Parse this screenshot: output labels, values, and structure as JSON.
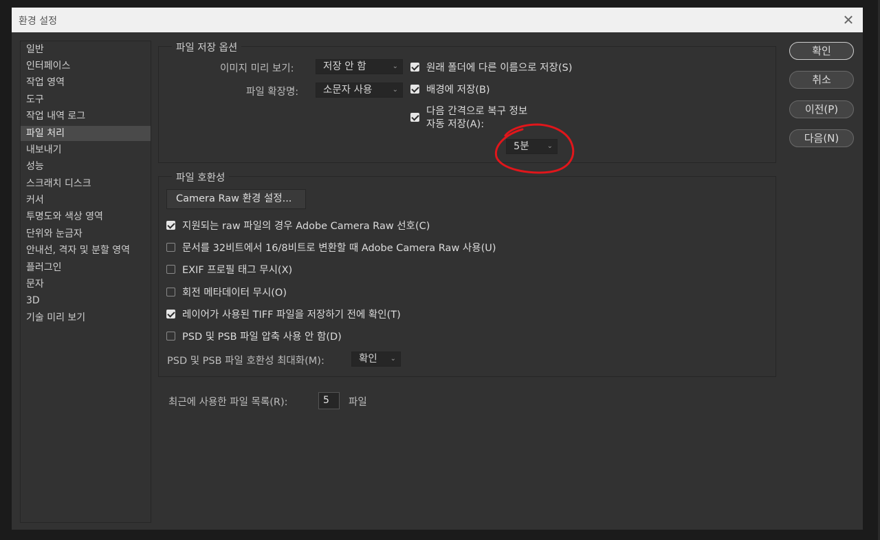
{
  "window": {
    "title": "환경 설정",
    "close_glyph": "✕"
  },
  "sidebar": {
    "items": [
      {
        "label": "일반"
      },
      {
        "label": "인터페이스"
      },
      {
        "label": "작업 영역"
      },
      {
        "label": "도구"
      },
      {
        "label": "작업 내역 로그"
      },
      {
        "label": "파일 처리",
        "selected": true
      },
      {
        "label": "내보내기"
      },
      {
        "label": "성능"
      },
      {
        "label": "스크래치 디스크"
      },
      {
        "label": "커서"
      },
      {
        "label": "투명도와 색상 영역"
      },
      {
        "label": "단위와 눈금자"
      },
      {
        "label": "안내선, 격자 및 분할 영역"
      },
      {
        "label": "플러그인"
      },
      {
        "label": "문자"
      },
      {
        "label": "3D"
      },
      {
        "label": "기술 미리 보기"
      }
    ]
  },
  "save_options": {
    "legend": "파일 저장 옵션",
    "image_preview_label": "이미지 미리 보기:",
    "image_preview_value": "저장 안 함",
    "file_ext_label": "파일 확장명:",
    "file_ext_value": "소문자 사용",
    "save_in_original_folder": {
      "label": "원래 폴더에 다른 이름으로 저장(S)",
      "checked": true
    },
    "save_in_background": {
      "label": "배경에 저장(B)",
      "checked": true
    },
    "auto_recovery": {
      "label_line1": "다음 간격으로 복구 정보",
      "label_line2": "자동 저장(A):",
      "checked": true
    },
    "interval_value": "5분"
  },
  "compat": {
    "legend": "파일 호환성",
    "camera_raw_button": "Camera Raw 환경 설정...",
    "options": [
      {
        "label": "지원되는 raw 파일의 경우 Adobe Camera Raw 선호(C)",
        "checked": true
      },
      {
        "label": "문서를 32비트에서 16/8비트로 변환할 때 Adobe Camera Raw 사용(U)",
        "checked": false
      },
      {
        "label": "EXIF 프로필 태그 무시(X)",
        "checked": false
      },
      {
        "label": "회전 메타데이터 무시(O)",
        "checked": false
      },
      {
        "label": "레이어가 사용된 TIFF 파일을 저장하기 전에 확인(T)",
        "checked": true
      },
      {
        "label": "PSD 및 PSB 파일 압축 사용 안 함(D)",
        "checked": false
      }
    ],
    "maximize_label": "PSD 및 PSB 파일 호환성 최대화(M):",
    "maximize_value": "확인"
  },
  "recent": {
    "label": "최근에 사용한 파일 목록(R):",
    "value": "5",
    "unit": "파일"
  },
  "buttons": {
    "ok": "확인",
    "cancel": "취소",
    "prev": "이전(P)",
    "next": "다음(N)"
  },
  "icons": {
    "chevron": "⌄"
  },
  "colors": {
    "annotation_circle": "#e0161b",
    "dialog_bg": "#323232",
    "selected_item": "#4a4a4a"
  }
}
